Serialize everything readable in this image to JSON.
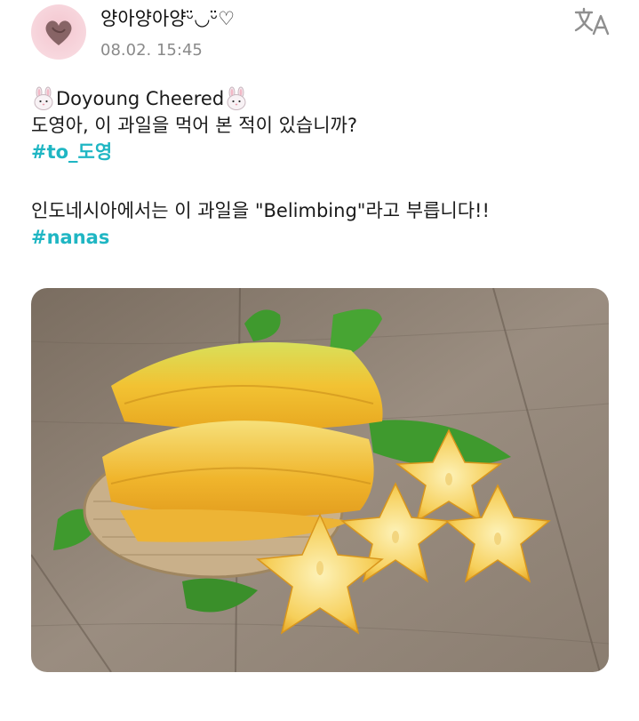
{
  "post": {
    "author": "양아양아양ᵕ̈◡ᵕ̈♡",
    "timestamp": "08.02. 15:45",
    "line1_text": "Doyoung Cheered",
    "line2": "도영아, 이 과일을 먹어 본 적이 있습니까?",
    "hashtag1": "#to_도영",
    "line4": "인도네시아에서는 이 과일을 \"Belimbing\"라고 부릅니다!!",
    "hashtag2": "#nanas"
  },
  "icons": {
    "avatar": "pink-heart-avatar",
    "translate": "translate-icon",
    "emoji": "rabbit-face-icon"
  },
  "colors": {
    "hashtag": "#1fb6c3",
    "timestamp": "#8a8a8a",
    "background": "#ffffff"
  }
}
